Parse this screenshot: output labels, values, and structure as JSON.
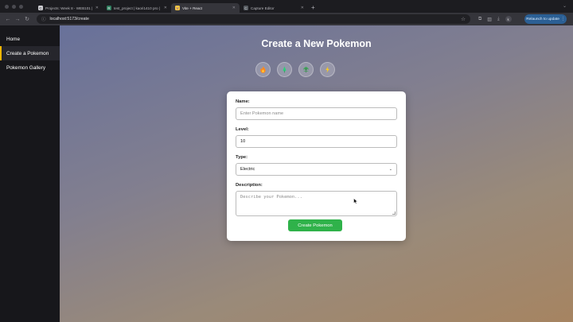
{
  "browser": {
    "tabs": [
      {
        "title": "Projects: Week 8 - WEB101 |",
        "favicon": "C",
        "fav_color": "#cfcfd4",
        "active": false
      },
      {
        "title": "test_project | kaori1410 pro |",
        "favicon": "R",
        "fav_color": "#2f7d5d",
        "active": false
      },
      {
        "title": "Vite + React",
        "favicon": "V",
        "fav_color": "#f5c542",
        "active": true
      },
      {
        "title": "Capture Editor",
        "favicon": "C",
        "fav_color": "#555a60",
        "active": false
      }
    ],
    "url": "localhost:5173/create",
    "relaunch_label": "Relaunch to update"
  },
  "sidebar": {
    "items": [
      {
        "label": "Home",
        "active": false
      },
      {
        "label": "Create a Pokemon",
        "active": true
      },
      {
        "label": "Pokemon Gallery",
        "active": false
      }
    ],
    "accent": "#f2b600"
  },
  "main": {
    "title": "Create a New Pokemon",
    "type_icons": [
      "fire-icon",
      "water-icon",
      "grass-icon",
      "electric-icon"
    ]
  },
  "form": {
    "name_label": "Name:",
    "name_placeholder": "Enter Pokemon name",
    "level_label": "Level:",
    "level_value": "10",
    "type_label": "Type:",
    "type_value": "Electric",
    "description_label": "Description:",
    "description_placeholder": "Describe your Pokemon...",
    "submit_label": "Create Pokemon",
    "submit_color": "#2fb24a"
  }
}
